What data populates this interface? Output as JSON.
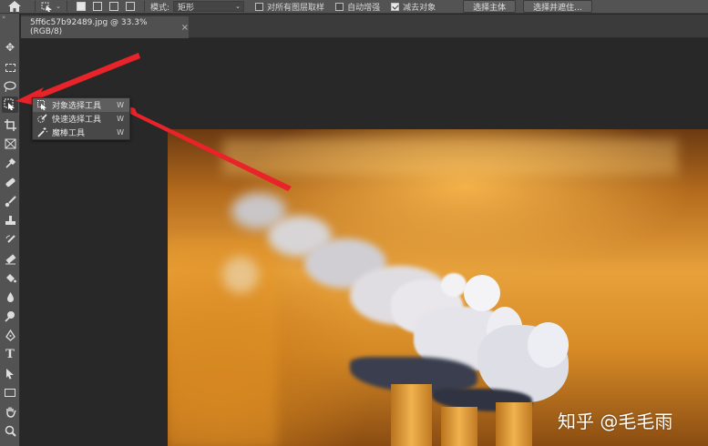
{
  "options_bar": {
    "home_icon": "home-icon",
    "mode_label": "模式:",
    "mode_value": "矩形",
    "sample_all_layers": "对所有图层取样",
    "auto_enhance": "自动增强",
    "subtract_object": "减去对象",
    "subtract_object_checked": true,
    "select_subject": "选择主体",
    "select_and_mask": "选择并遮住..."
  },
  "tab": {
    "title": "5ff6c57b92489.jpg @ 33.3%(RGB/8)",
    "close": "×"
  },
  "flyout": {
    "items": [
      {
        "label": "对象选择工具",
        "shortcut": "W",
        "icon": "object-selection-icon"
      },
      {
        "label": "快速选择工具",
        "shortcut": "W",
        "icon": "quick-selection-icon"
      },
      {
        "label": "魔棒工具",
        "shortcut": "W",
        "icon": "magic-wand-icon"
      }
    ]
  },
  "watermark": "知乎 @毛毛雨",
  "colors": {
    "ui_panel": "#535353",
    "workspace": "#282828",
    "arrow_red": "#e8232a"
  }
}
